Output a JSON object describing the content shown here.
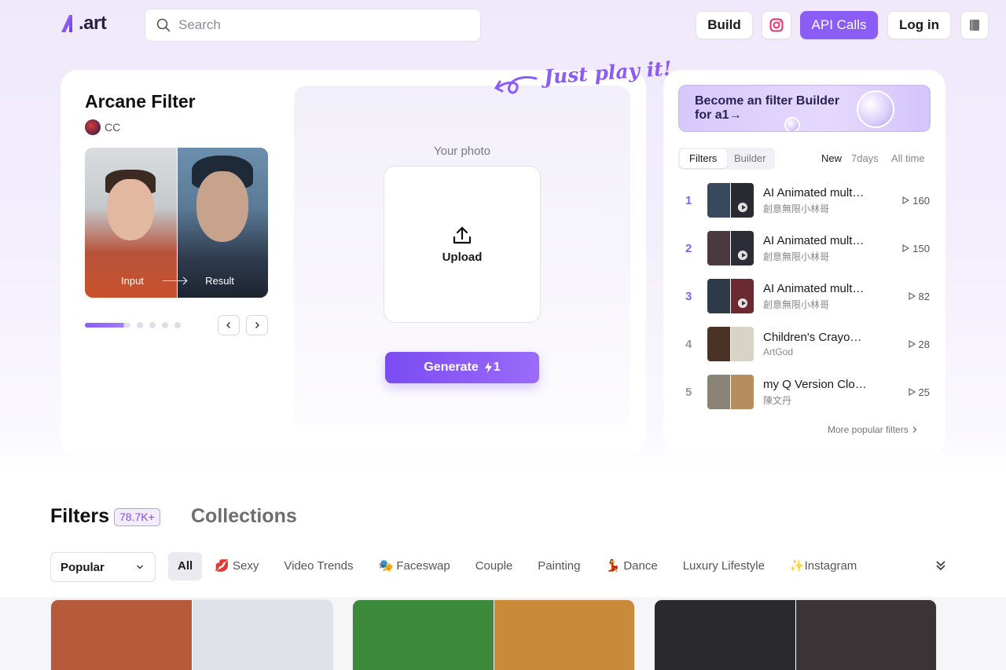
{
  "header": {
    "logo_text": ".art",
    "search_placeholder": "Search",
    "build_label": "Build",
    "api_label": "API Calls",
    "login_label": "Log in"
  },
  "hero": {
    "title": "Arcane Filter",
    "author": "CC",
    "input_label": "Input",
    "result_label": "Result",
    "tagline": "Just play it!",
    "your_photo_label": "Your photo",
    "upload_label": "Upload",
    "generate_label": "Generate",
    "generate_cost": "1"
  },
  "side": {
    "banner_line1": "Become an filter Builder",
    "banner_line2": "for a1→",
    "tabs": [
      "Filters",
      "Builder"
    ],
    "periods": [
      "New",
      "7days",
      "All time"
    ],
    "rankings": [
      {
        "rank": "1",
        "title": "AI Animated mult…",
        "author": "創意無限小林哥",
        "count": "160",
        "c1": "#3a4a5e",
        "c2": "#2a2a33"
      },
      {
        "rank": "2",
        "title": "AI Animated mult…",
        "author": "創意無限小林哥",
        "count": "150",
        "c1": "#4a3a40",
        "c2": "#2d2d38"
      },
      {
        "rank": "3",
        "title": "AI Animated mult…",
        "author": "創意無限小林哥",
        "count": "82",
        "c1": "#2f3a48",
        "c2": "#6a2a30"
      },
      {
        "rank": "4",
        "title": "Children's Crayo…",
        "author": "ArtGod",
        "count": "28",
        "c1": "#4a3326",
        "c2": "#d9d2c6"
      },
      {
        "rank": "5",
        "title": "my Q Version Clo…",
        "author": "陳文丹",
        "count": "25",
        "c1": "#8a8478",
        "c2": "#b58d5e"
      }
    ],
    "more_label": "More popular filters"
  },
  "filters": {
    "title": "Filters",
    "count": "78.7K+",
    "collections_label": "Collections",
    "sort_label": "Popular",
    "categories": [
      "All",
      "💋 Sexy",
      "Video Trends",
      "🎭 Faceswap",
      "Couple",
      "Painting",
      "💃 Dance",
      "Luxury Lifestyle",
      "✨Instagram"
    ]
  },
  "cards": [
    {
      "c1": "#b65a3c",
      "c2": "#dfe2e8"
    },
    {
      "c1": "#3d8a3c",
      "c2": "#c98a3a"
    },
    {
      "c1": "#2a2a2e",
      "c2": "#3a3436"
    }
  ],
  "colors": {
    "accent": "#8b5cf6",
    "instagram": "#e1306c"
  }
}
